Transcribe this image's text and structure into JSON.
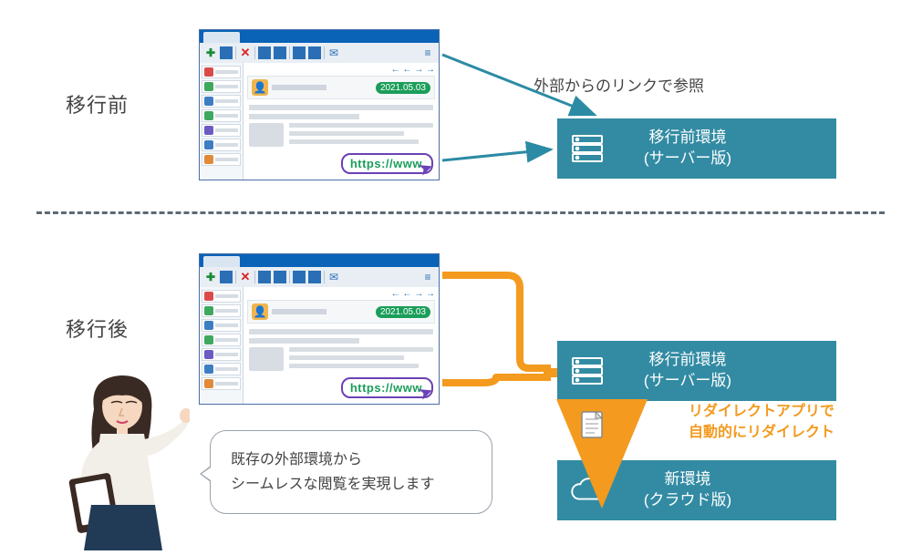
{
  "sections": {
    "before": "移行前",
    "after": "移行後"
  },
  "annotations": {
    "external_link": "外部からのリンクで参照",
    "redirect_line1": "リダイレクトアプリで",
    "redirect_line2": "自動的にリダイレクト"
  },
  "envs": {
    "old_line1": "移行前環境",
    "old_line2": "(サーバー版)",
    "new_line1": "新環境",
    "new_line2": "(クラウド版)"
  },
  "app": {
    "date_badge": "2021.05.03",
    "url_badge": "https://www"
  },
  "speech": {
    "line1": "既存の外部環境から",
    "line2": "シームレスな閲覧を実現します"
  },
  "colors": {
    "teal": "#328ba3",
    "orange": "#f39a1f",
    "arrow_blue": "#2c8ba4",
    "url_border": "#6b42b5",
    "url_text": "#1b9e5a"
  }
}
